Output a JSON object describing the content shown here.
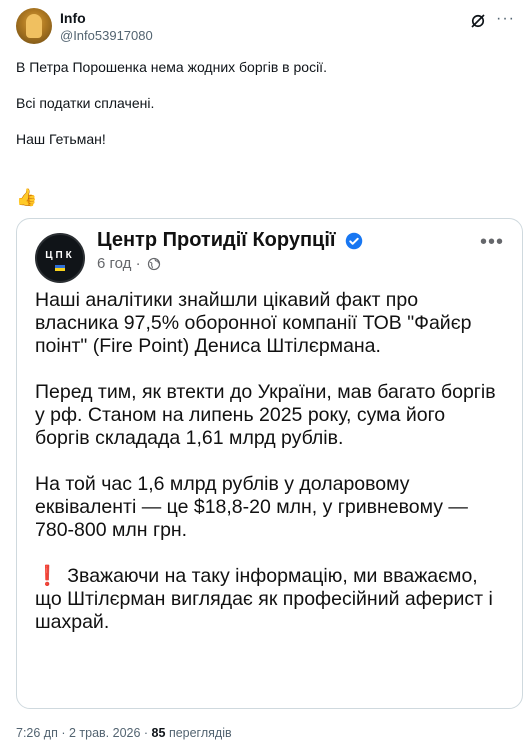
{
  "post": {
    "author_name": "Info",
    "author_handle": "@Info53917080",
    "paragraphs": [
      "В Петра Порошенка нема жодних боргів в росії.",
      "Всі податки сплачені.",
      "Наш Гетьман!"
    ],
    "emoji": "👍",
    "more_label": "···"
  },
  "quoted": {
    "logo_text": "ЦПК",
    "page_name": "Центр Протидії Корупції",
    "time_text": "6 год",
    "separator": "·",
    "more_label": "•••",
    "paragraphs": [
      "Наші аналітики знайшли цікавий факт про власника 97,5% оборонної компанії ТОВ \"Файєр поінт\" (Fire Point) Дениса Штілєрмана.",
      "Перед тим, як втекти до України, мав багато боргів у рф. Станом на липень 2025 року, сума його боргів складада 1,61 млрд  рублів.",
      "На той час 1,6 млрд рублів у доларовому еквіваленті — це $18,8-20 млн, у гривневому — 780-800 млн грн."
    ],
    "last_paragraph_mark": "❗",
    "last_paragraph": "Зважаючи на таку інформацію, ми вважаємо, що Штілєрман виглядає як професійний аферист і шахрай.",
    "accent_color": "#1877f2",
    "alert_color": "#e0242d"
  },
  "footer": {
    "timestamp": "7:26 дп · 2 трав. 2026 ·",
    "views_count": "85",
    "views_label": "переглядів"
  }
}
